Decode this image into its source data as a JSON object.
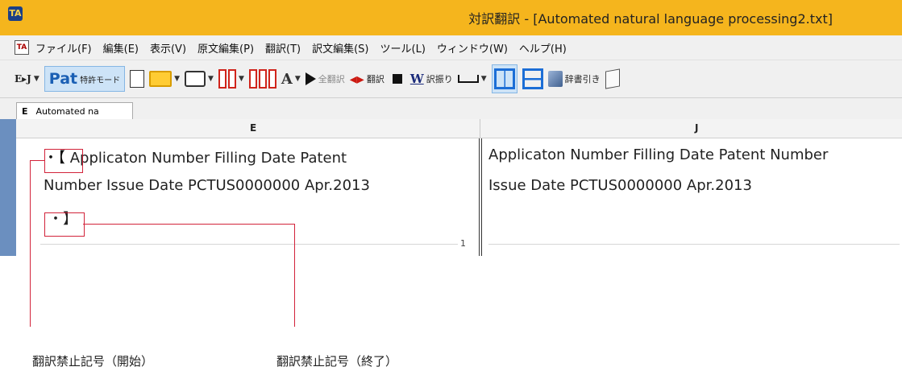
{
  "window": {
    "app_icon": "TA",
    "title": "対訳翻訳 - [Automated natural language processing2.txt]"
  },
  "menu": {
    "items": [
      "ファイル(F)",
      "編集(E)",
      "表示(V)",
      "原文編集(P)",
      "翻訳(T)",
      "訳文編集(S)",
      "ツール(L)",
      "ウィンドウ(W)",
      "ヘルプ(H)"
    ]
  },
  "toolbar": {
    "direction_label": "E▸J",
    "patent_logo": "Pat",
    "patent_mode_label": "特許モード",
    "font_glyph": "A",
    "translate_all_label": "全翻訳",
    "translate_label": "翻訳",
    "w_glyph": "W",
    "furigana_label": "訳振り",
    "dictionary_label": "辞書引き"
  },
  "tab": {
    "letter": "E",
    "label": "Automated na"
  },
  "columns": {
    "source_header": "E",
    "target_header": "J"
  },
  "source": {
    "start_mark": "・【",
    "line1": "Applicaton Number Filling Date Patent",
    "line2": "Number Issue Date PCTUS0000000 Apr.2013",
    "end_mark": "・】",
    "segment_number": "1"
  },
  "target": {
    "line1": "Applicaton Number Filling Date Patent Number",
    "line2": "Issue Date PCTUS0000000 Apr.2013"
  },
  "annotations": {
    "start_caption": "翻訳禁止記号（開始）",
    "end_caption": "翻訳禁止記号（終了）",
    "callout_color": "#d2233a"
  }
}
